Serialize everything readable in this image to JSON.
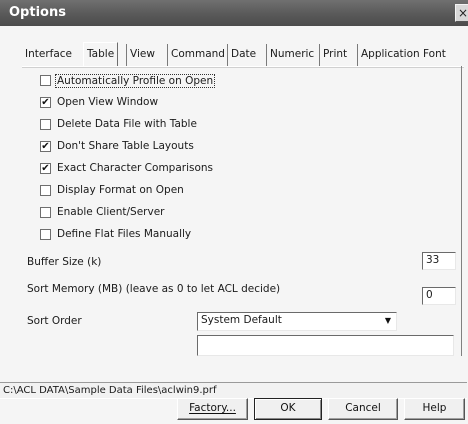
{
  "window": {
    "title": "Options",
    "close_glyph": "×"
  },
  "tabs": [
    {
      "label": "Interface",
      "active": false
    },
    {
      "label": "Table",
      "active": true
    },
    {
      "label": "View",
      "active": false
    },
    {
      "label": "Command",
      "active": false
    },
    {
      "label": "Date",
      "active": false
    },
    {
      "label": "Numeric",
      "active": false
    },
    {
      "label": "Print",
      "active": false
    },
    {
      "label": "Application Font",
      "active": false
    }
  ],
  "options": [
    {
      "label": "Automatically Profile on Open",
      "checked": false
    },
    {
      "label": "Open View Window",
      "checked": true
    },
    {
      "label": "Delete Data File with Table",
      "checked": false
    },
    {
      "label": "Don't Share Table Layouts",
      "checked": true
    },
    {
      "label": "Exact Character Comparisons",
      "checked": true
    },
    {
      "label": "Display Format on Open",
      "checked": false
    },
    {
      "label": "Enable Client/Server",
      "checked": false
    },
    {
      "label": "Define Flat Files Manually",
      "checked": false
    }
  ],
  "check_glyph": "✔",
  "buffer_size": {
    "label": "Buffer Size (k)",
    "value": "33"
  },
  "sort_memory": {
    "label": "Sort Memory (MB) (leave as 0 to let ACL decide)",
    "value": "0"
  },
  "sort_order": {
    "label": "Sort Order",
    "selected": "System Default",
    "arrow": "▼",
    "extra_value": ""
  },
  "status": {
    "path": "C:\\ACL DATA\\Sample Data Files\\aclwin9.prf"
  },
  "buttons": {
    "factory": "Factory...",
    "ok": "OK",
    "cancel": "Cancel",
    "help": "Help"
  }
}
